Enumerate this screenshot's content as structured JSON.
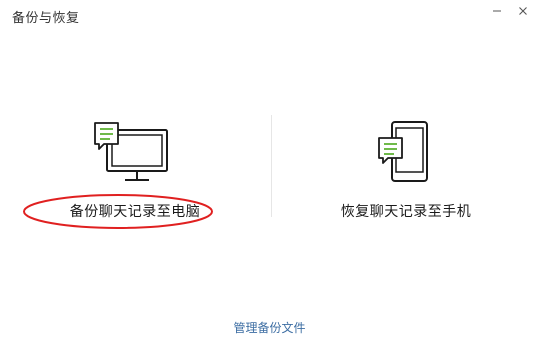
{
  "window": {
    "title": "备份与恢复",
    "controls": {
      "minimize_icon": "minimize-icon",
      "close_icon": "close-icon"
    }
  },
  "options": {
    "backup": {
      "label": "备份聊天记录至电脑",
      "icon": "computer-chat-icon"
    },
    "restore": {
      "label": "恢复聊天记录至手机",
      "icon": "phone-chat-icon"
    }
  },
  "footer": {
    "manage_link": "管理备份文件"
  },
  "colors": {
    "accent_green": "#5fb236",
    "icon_stroke": "#1a1a1a",
    "annotation_red": "#e02020",
    "link_blue": "#3d6ea3"
  }
}
